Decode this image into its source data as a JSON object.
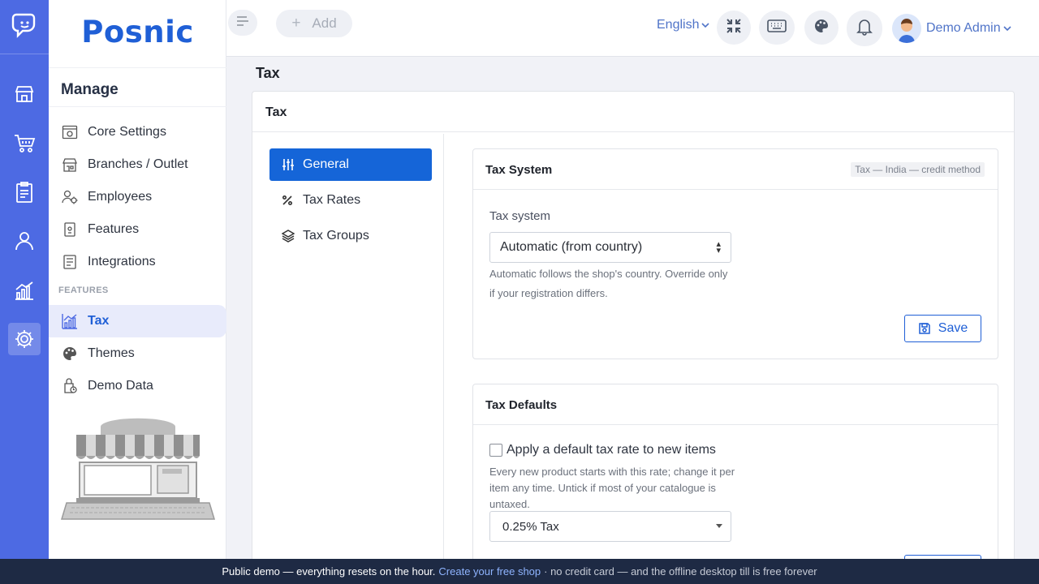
{
  "brand": {
    "name": "Posnic"
  },
  "rail": {
    "items": [
      {
        "icon": "store-icon"
      },
      {
        "icon": "cart-icon"
      },
      {
        "icon": "clipboard-icon"
      },
      {
        "icon": "user-icon"
      },
      {
        "icon": "chart-icon"
      },
      {
        "icon": "gear-icon",
        "active": true
      }
    ]
  },
  "sidebar": {
    "title": "Manage",
    "items": [
      {
        "label": "Core Settings",
        "icon": "settings-window-icon"
      },
      {
        "label": "Branches / Outlet",
        "icon": "branch-store-icon"
      },
      {
        "label": "Employees",
        "icon": "employees-icon"
      },
      {
        "label": "Features",
        "icon": "features-icon"
      },
      {
        "label": "Integrations",
        "icon": "integrations-icon"
      }
    ],
    "section_heading": "FEATURES",
    "feature_items": [
      {
        "label": "Tax",
        "icon": "tax-chart-icon",
        "active": true
      },
      {
        "label": "Themes",
        "icon": "palette-icon"
      },
      {
        "label": "Demo Data",
        "icon": "demo-data-icon"
      }
    ]
  },
  "topbar": {
    "add_label": "Add",
    "language": "English",
    "user_name": "Demo Admin"
  },
  "page": {
    "title": "Tax",
    "card_title": "Tax",
    "tabs": [
      {
        "label": "General",
        "active": true
      },
      {
        "label": "Tax Rates"
      },
      {
        "label": "Tax Groups"
      }
    ]
  },
  "tax_system": {
    "title": "Tax System",
    "badge": "Tax — India — credit method",
    "field_label": "Tax system",
    "selected": "Automatic (from country)",
    "help": "Automatic follows the shop's country. Override only if your registration differs.",
    "save_label": "Save"
  },
  "tax_defaults": {
    "title": "Tax Defaults",
    "checkbox_label": "Apply a default tax rate to new items",
    "checked": false,
    "help": "Every new product starts with this rate; change it per item any time. Untick if most of your catalogue is untaxed.",
    "selected": "0.25% Tax"
  },
  "banner": {
    "text1": "Public demo — everything resets on the hour.",
    "link": "Create your free shop",
    "text2": "· no credit card — and the offline desktop till is free forever"
  },
  "colors": {
    "rail": "#4d6ae3",
    "brand": "#1f5fd6",
    "active_tab": "#1565d8",
    "banner": "#1e2a44"
  }
}
